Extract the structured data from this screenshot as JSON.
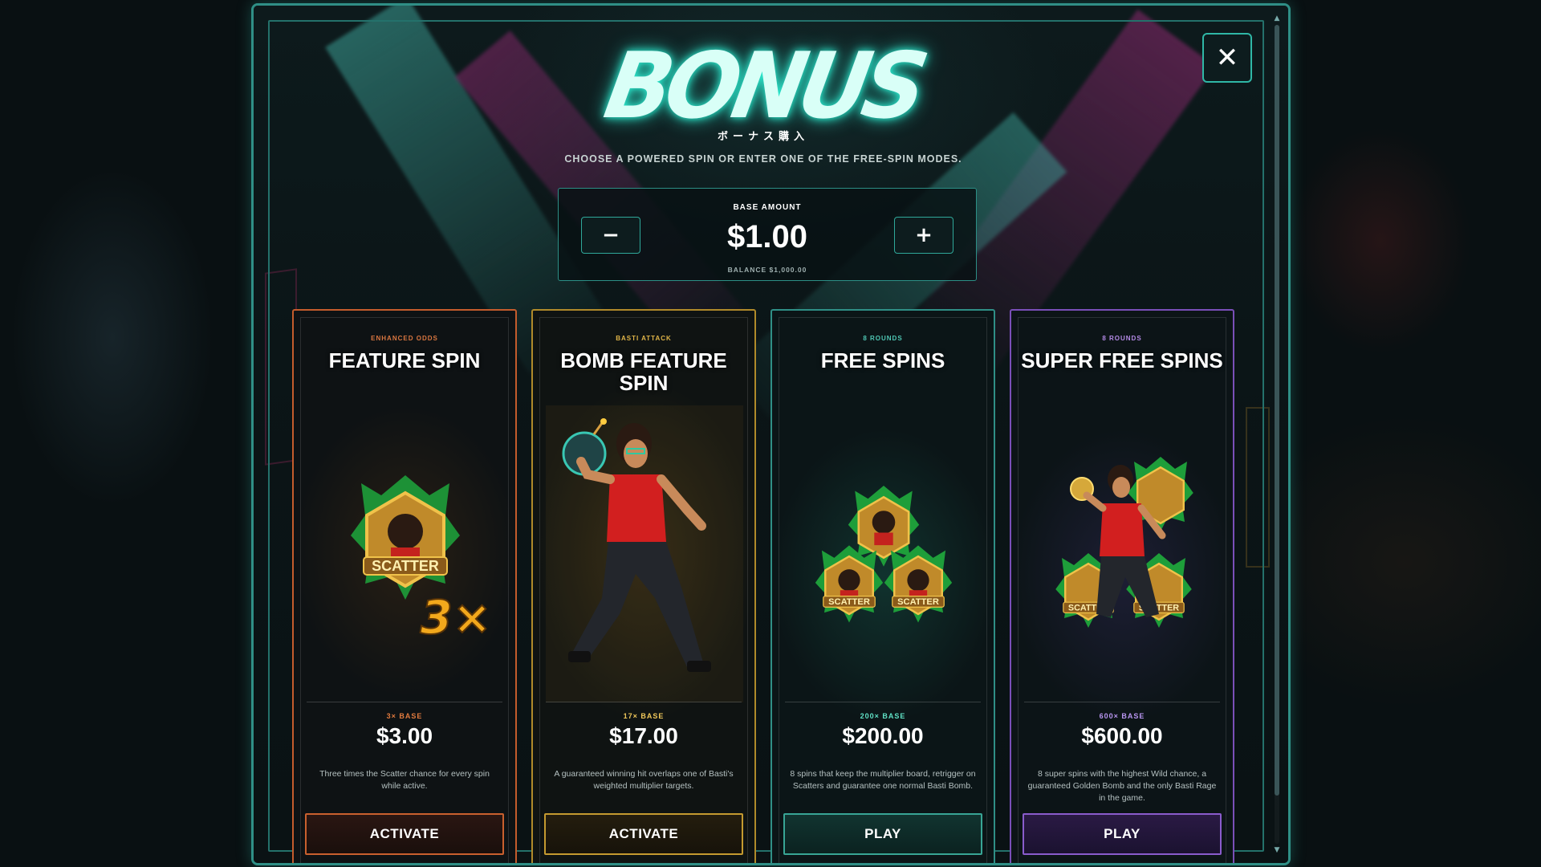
{
  "modal": {
    "title": "BONUS",
    "title_jp": "ボーナス購入",
    "subtitle": "CHOOSE A POWERED SPIN OR ENTER ONE OF THE FREE-SPIN MODES.",
    "close_label": "✕"
  },
  "base": {
    "label": "BASE AMOUNT",
    "amount": "$1.00",
    "balance": "BALANCE $1,000.00",
    "minus_label": "−",
    "plus_label": "+"
  },
  "cards": [
    {
      "tag": "ENHANCED ODDS",
      "title": "FEATURE SPIN",
      "multiplier": "3× BASE",
      "price": "$3.00",
      "description": "Three times the Scatter chance for every spin while active.",
      "action": "ACTIVATE",
      "art_label": "SCATTER",
      "badge": "3×"
    },
    {
      "tag": "BASTI ATTACK",
      "title": "BOMB FEATURE SPIN",
      "multiplier": "17× BASE",
      "price": "$17.00",
      "description": "A guaranteed winning hit overlaps one of Basti's weighted multiplier targets.",
      "action": "ACTIVATE"
    },
    {
      "tag": "8 ROUNDS",
      "title": "FREE SPINS",
      "multiplier": "200× BASE",
      "price": "$200.00",
      "description": "8 spins that keep the multiplier board, retrigger on Scatters and guarantee one normal Basti Bomb.",
      "action": "PLAY",
      "art_labels": [
        "SCATTER",
        "SCATTER",
        "SCATTER"
      ]
    },
    {
      "tag": "8 ROUNDS",
      "title": "SUPER FREE SPINS",
      "multiplier": "600× BASE",
      "price": "$600.00",
      "description": "8 super spins with the highest Wild chance, a guaranteed Golden Bomb and the only Basti Rage in the game.",
      "action": "PLAY",
      "art_labels": [
        "SCATTER",
        "SCATTER",
        "SCATTER"
      ]
    }
  ],
  "colors": {
    "accent": "#2fb7a6",
    "orange": "#c45c2c",
    "gold": "#b08a2a",
    "teal": "#2f8f86",
    "purple": "#7a4fb8"
  },
  "icons": [
    "close-icon",
    "minus-icon",
    "plus-icon",
    "scroll-up-icon",
    "scroll-down-icon"
  ]
}
